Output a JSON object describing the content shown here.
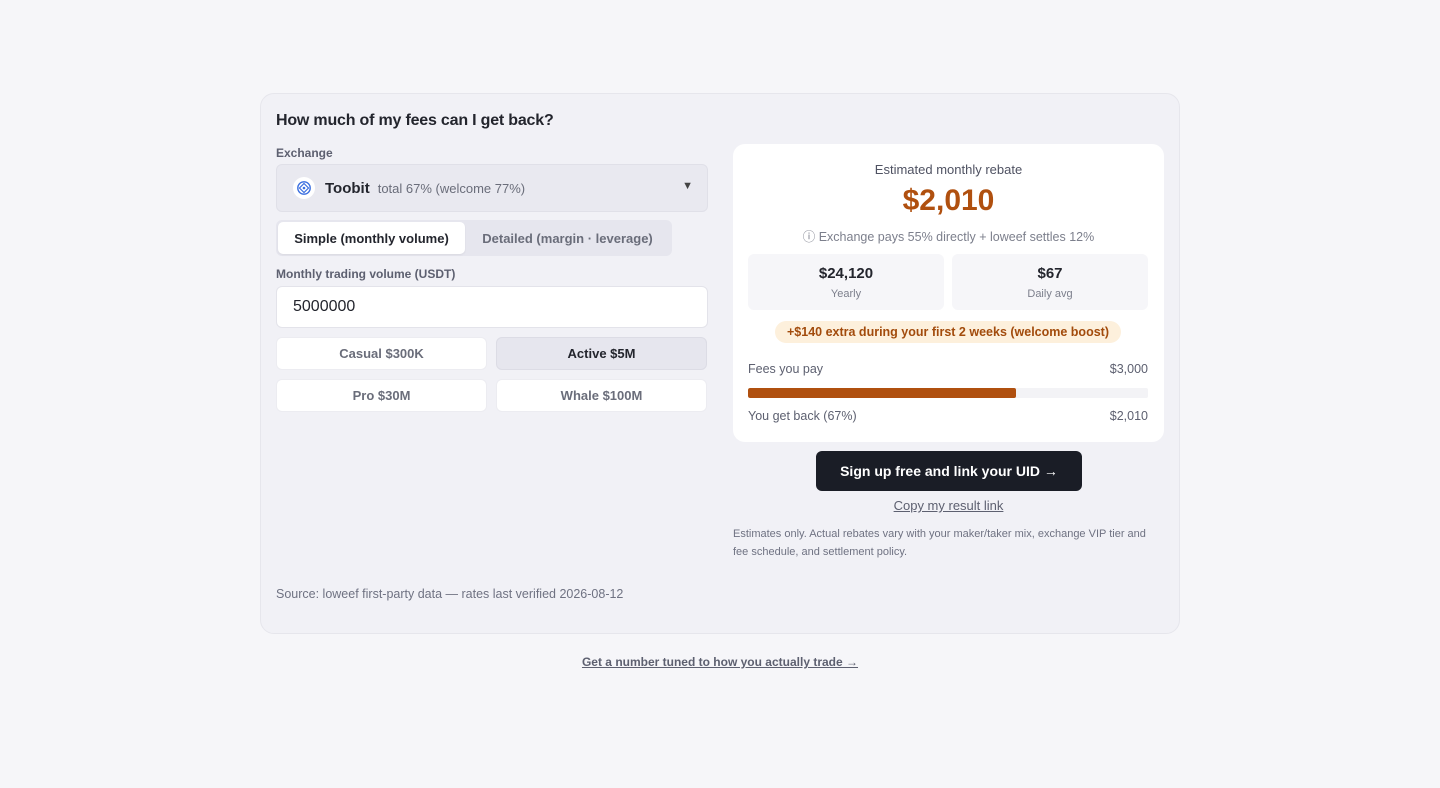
{
  "calculator": {
    "title": "How much of my fees can I get back?",
    "exchange_label": "Exchange",
    "exchange": {
      "name": "Toobit",
      "meta": "total 67% (welcome 77%)"
    },
    "modes": [
      "Simple (monthly volume)",
      "Detailed (margin · leverage)"
    ],
    "volume_label": "Monthly trading volume (USDT)",
    "volume_value": "5000000",
    "presets": [
      "Casual $300K",
      "Active $5M",
      "Pro $30M",
      "Whale $100M"
    ],
    "active_preset": "Active $5M",
    "source": "Source: loweef first-party data — rates last verified 2026-08-12"
  },
  "result": {
    "heading": "Estimated monthly rebate",
    "amount": "$2,010",
    "note": "ⓘ Exchange pays 55% directly + loweef settles 12%",
    "yearly_value": "$24,120",
    "yearly_label": "Yearly",
    "daily_value": "$67",
    "daily_label": "Daily avg",
    "boost": "+$140 extra during your first 2 weeks (welcome boost)",
    "fees_label": "Fees you pay",
    "fees_value": "$3,000",
    "back_label": "You get back (67%)",
    "back_value": "$2,010",
    "rebate_fraction": 0.67
  },
  "actions": {
    "cta": "Sign up free and link your UID →",
    "copy": "Copy my result link",
    "disclaimer": "Estimates only. Actual rebates vary with your maker/taker mix, exchange VIP tier and fee schedule, and settlement policy.",
    "tune": "Get a number tuned to how you actually trade →"
  },
  "colors": {
    "accent": "#b0500f",
    "cta_bg": "#1a1d26",
    "boost_bg": "#fdf0dc",
    "exchange_logo": "#3b6fe0"
  },
  "icons": {
    "exchange_logo": "toobit-logo-icon",
    "caret": "chevron-down-icon",
    "info": "info-icon"
  }
}
